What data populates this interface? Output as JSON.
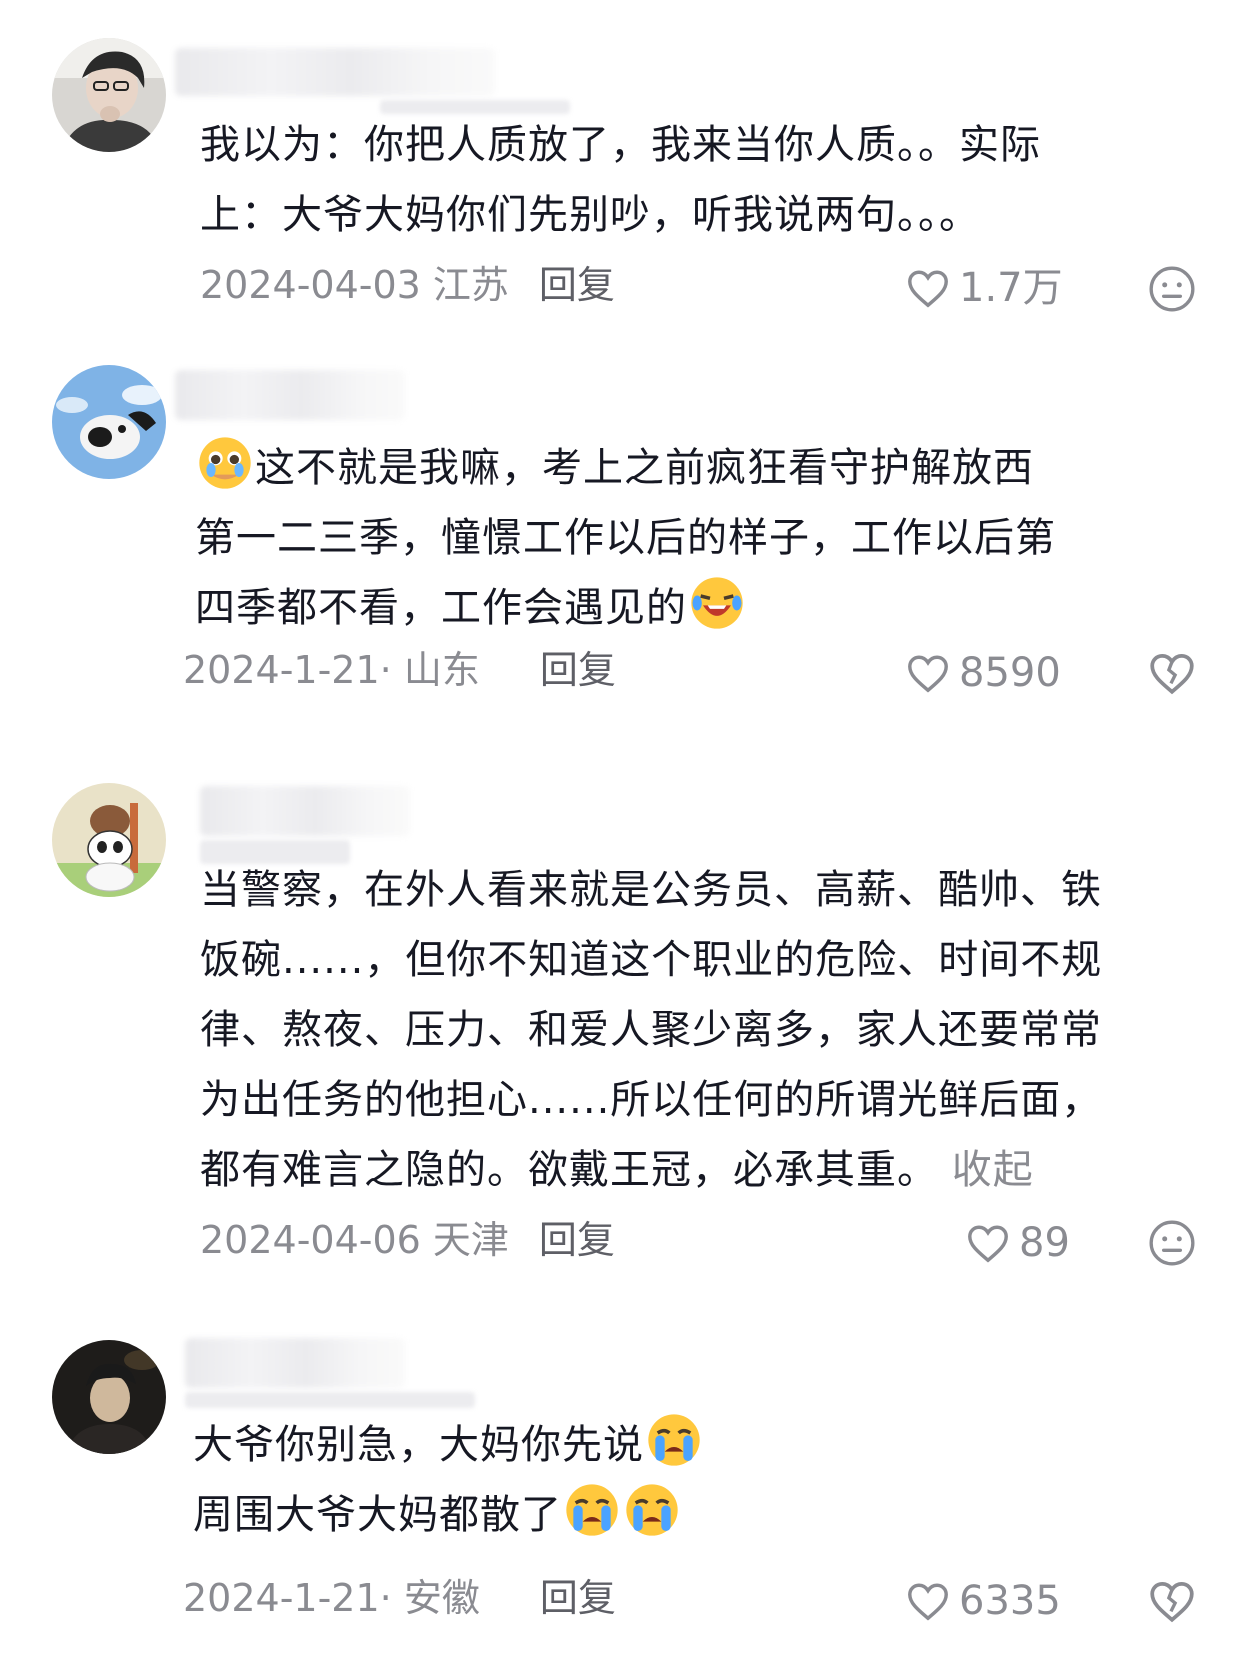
{
  "comments": [
    {
      "lines": [
        "我以为：你把人质放了，我来当你人质。。实际",
        "上：大爷大妈你们先别吵，听我说两句。。。"
      ],
      "date": "2024-04-03 江苏",
      "reply_label": "回复",
      "likes": "1.7万",
      "dislike_icon": "neutral-face-icon"
    },
    {
      "lines": [
        "这不就是我嘛，考上之前疯狂看守护解放西",
        "第一二三季，憧憬工作以后的样子，工作以后第",
        "四季都不看，工作会遇见的"
      ],
      "date": "2024-1-21· 山东",
      "reply_label": "回复",
      "likes": "8590",
      "dislike_icon": "broken-heart-icon"
    },
    {
      "lines": [
        "当警察，在外人看来就是公务员、高薪、酷帅、铁",
        "饭碗......，但你不知道这个职业的危险、时间不规",
        "律、熬夜、压力、和爱人聚少离多，家人还要常常",
        "为出任务的他担心......所以任何的所谓光鲜后面，",
        "都有难言之隐的。欲戴王冠，必承其重。"
      ],
      "collapse_label": "收起",
      "date": "2024-04-06 天津",
      "reply_label": "回复",
      "likes": "89",
      "dislike_icon": "neutral-face-icon"
    },
    {
      "lines": [
        "大爷你别急，大妈你先说",
        "周围大爷大妈都散了"
      ],
      "date": "2024-1-21· 安徽",
      "reply_label": "回复",
      "likes": "6335",
      "dislike_icon": "broken-heart-icon"
    }
  ],
  "colors": {
    "text": "#161823",
    "meta": "#8a8b91",
    "emoji": "#ffc83d"
  }
}
